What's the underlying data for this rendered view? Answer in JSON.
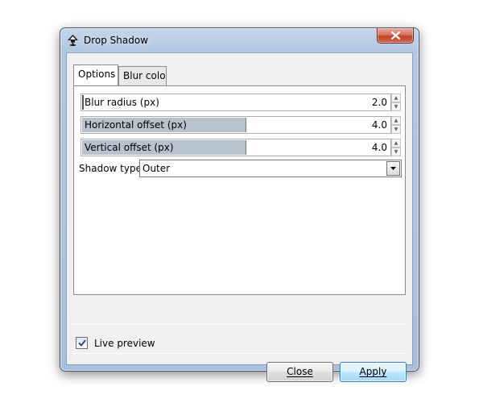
{
  "window": {
    "title": "Drop Shadow",
    "app_icon": "inkscape-logo-icon",
    "close_icon": "close-x-icon"
  },
  "tabs": [
    {
      "label": "Options",
      "active": true
    },
    {
      "label": "Blur color",
      "active": false
    }
  ],
  "options": {
    "blur_radius": {
      "label": "Blur radius (px)",
      "value": "2.0",
      "fill": 0.0
    },
    "horizontal_offset": {
      "label": "Horizontal offset (px)",
      "value": "4.0",
      "fill": 0.53
    },
    "vertical_offset": {
      "label": "Vertical offset (px)",
      "value": "4.0",
      "fill": 0.53
    },
    "shadow_type": {
      "label": "Shadow type:",
      "value": "Outer"
    }
  },
  "live_preview": {
    "label": "Live preview",
    "checked": true
  },
  "buttons": {
    "close": "Close",
    "apply": "Apply"
  }
}
